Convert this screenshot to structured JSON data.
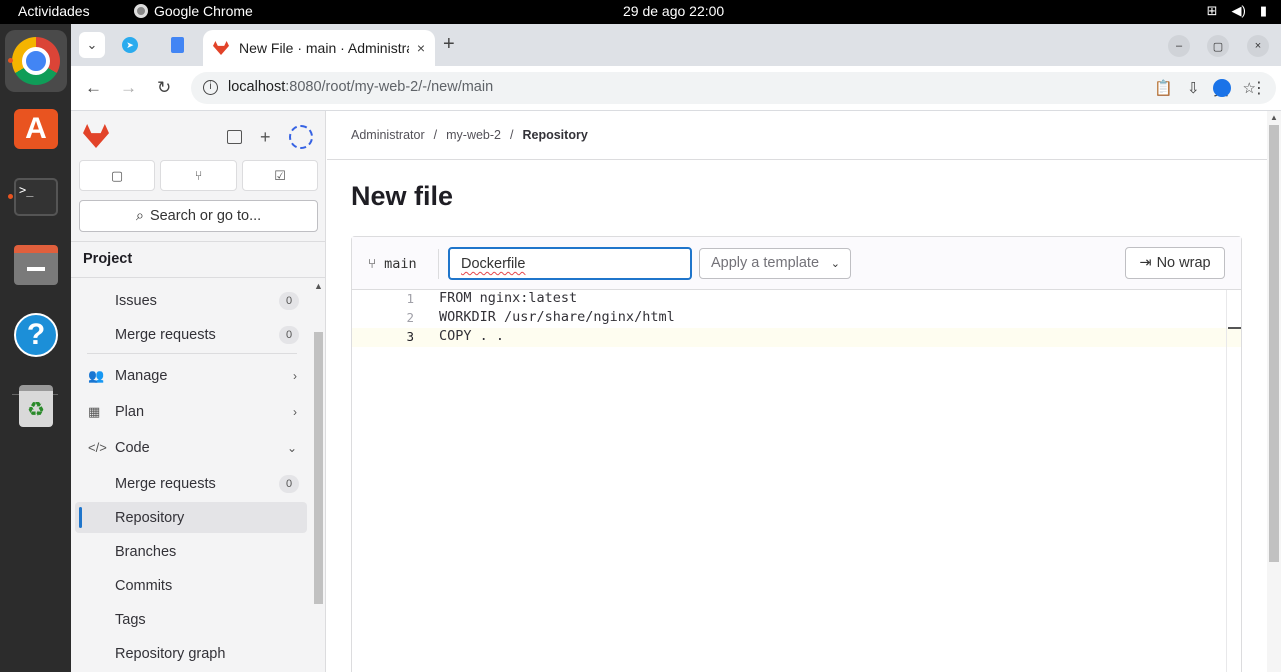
{
  "os": {
    "activities": "Actividades",
    "app_name": "Google Chrome",
    "clock": "29 de ago  22:00",
    "tray_icons": [
      "network-icon",
      "volume-icon",
      "battery-icon"
    ]
  },
  "dock": {
    "apps": [
      "chrome",
      "app-center",
      "terminal",
      "files",
      "help",
      "trash"
    ]
  },
  "browser": {
    "active_tab_title": "New File · main · Administrator",
    "close_tab": "×",
    "new_tab": "+",
    "url_host": "localhost",
    "url_rest": ":8080/root/my-web-2/-/new/main",
    "minimize": "–",
    "maximize": "▢",
    "close": "×"
  },
  "sidebar": {
    "search_label": "Search or go to...",
    "section_title": "Project",
    "items": [
      {
        "label": "Issues",
        "badge": "0"
      },
      {
        "label": "Merge requests",
        "badge": "0"
      },
      {
        "label": "Manage"
      },
      {
        "label": "Plan"
      },
      {
        "label": "Code"
      },
      {
        "label": "Merge requests",
        "badge": "0"
      },
      {
        "label": "Repository"
      },
      {
        "label": "Branches"
      },
      {
        "label": "Commits"
      },
      {
        "label": "Tags"
      },
      {
        "label": "Repository graph"
      }
    ]
  },
  "main": {
    "breadcrumb": [
      "Administrator",
      "my-web-2",
      "Repository"
    ],
    "breadcrumb_sep": "/",
    "title": "New file",
    "branch": "main",
    "filename": "Dockerfile",
    "template_label": "Apply a template",
    "nowrap_label": "No wrap",
    "code_lines": [
      {
        "n": "1",
        "text": "FROM nginx:latest"
      },
      {
        "n": "2",
        "text": "WORKDIR /usr/share/nginx/html"
      },
      {
        "n": "3",
        "text": "COPY . ."
      }
    ]
  }
}
